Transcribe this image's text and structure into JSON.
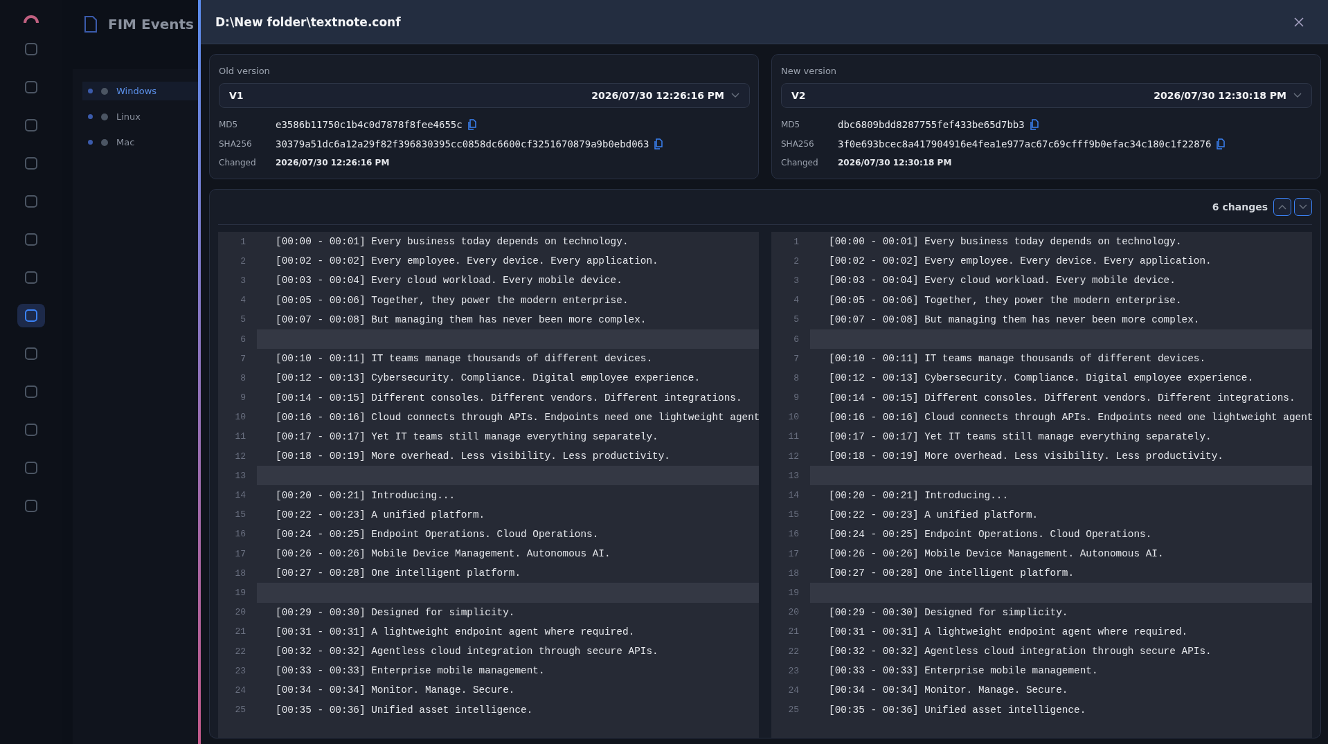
{
  "background_app": {
    "title": "FIM Events",
    "nav_icons": [
      {
        "selected": false
      },
      {
        "selected": false
      },
      {
        "selected": false
      },
      {
        "selected": false
      },
      {
        "selected": false
      },
      {
        "selected": false
      },
      {
        "selected": false
      },
      {
        "selected": true
      },
      {
        "selected": false
      },
      {
        "selected": false
      },
      {
        "selected": false
      },
      {
        "selected": false
      },
      {
        "selected": false
      }
    ],
    "tree": [
      {
        "label": "Windows",
        "selected": true
      },
      {
        "label": "Linux",
        "selected": false
      },
      {
        "label": "Mac",
        "selected": false
      }
    ]
  },
  "dialog": {
    "title": "D:\\New folder\\textnote.conf",
    "versions": [
      {
        "heading": "Old version",
        "version": "V1",
        "date": "2026/07/30 12:26:16 PM",
        "md5_label": "MD5",
        "md5": "e3586b11750c1b4c0d7878f8fee4655c",
        "sha_label": "SHA256",
        "sha256": "30379a51dc6a12a29f82f396830395cc0858dc6600cf3251670879a9b0ebd063",
        "changed_label": "Changed",
        "changed": "2026/07/30 12:26:16 PM"
      },
      {
        "heading": "New version",
        "version": "V2",
        "date": "2026/07/30 12:30:18 PM",
        "md5_label": "MD5",
        "md5": "dbc6809bdd8287755fef433be65d7bb3",
        "sha_label": "SHA256",
        "sha256": "3f0e693bcec8a417904916e4fea1e977ac67c69cfff9b0efac34c180c1f22876",
        "changed_label": "Changed",
        "changed": "2026/07/30 12:30:18 PM"
      }
    ],
    "changes": "6 changes",
    "rows": [
      {
        "old_number": "1",
        "old_text": "[00:00 - 00:01] Every business today depends on technology.",
        "new_number": "1",
        "new_text": "[00:00 - 00:01] Every business today depends on technology.",
        "changed": false
      },
      {
        "old_number": "2",
        "old_text": "[00:02 - 00:02] Every employee. Every device. Every application.",
        "new_number": "2",
        "new_text": "[00:02 - 00:02] Every employee. Every device. Every application.",
        "changed": false
      },
      {
        "old_number": "3",
        "old_text": "[00:03 - 00:04] Every cloud workload. Every mobile device.",
        "new_number": "3",
        "new_text": "[00:03 - 00:04] Every cloud workload. Every mobile device.",
        "changed": false
      },
      {
        "old_number": "4",
        "old_text": "[00:05 - 00:06] Together, they power the modern enterprise.",
        "new_number": "4",
        "new_text": "[00:05 - 00:06] Together, they power the modern enterprise.",
        "changed": false
      },
      {
        "old_number": "5",
        "old_text": "[00:07 - 00:08] But managing them has never been more complex.",
        "new_number": "5",
        "new_text": "[00:07 - 00:08] But managing them has never been more complex.",
        "changed": false
      },
      {
        "old_number": "6",
        "new_number": "6",
        "changed": true
      },
      {
        "old_number": "7",
        "old_text": "[00:10 - 00:11] IT teams manage thousands of different devices.",
        "new_number": "7",
        "new_text": "[00:10 - 00:11] IT teams manage thousands of different devices.",
        "changed": false
      },
      {
        "old_number": "8",
        "old_text": "[00:12 - 00:13] Cybersecurity. Compliance. Digital employee experience.",
        "new_number": "8",
        "new_text": "[00:12 - 00:13] Cybersecurity. Compliance. Digital employee experience.",
        "changed": false
      },
      {
        "old_number": "9",
        "old_text": "[00:14 - 00:15] Different consoles. Different vendors. Different integrations.",
        "new_number": "9",
        "new_text": "[00:14 - 00:15] Different consoles. Different vendors. Different integrations.",
        "changed": false
      },
      {
        "old_number": "10",
        "old_text": "[00:16 - 00:16] Cloud connects through APIs. Endpoints need one lightweight agent",
        "new_number": "10",
        "new_text": "[00:16 - 00:16] Cloud connects through APIs. Endpoints need one lightweight agent",
        "changed": false
      },
      {
        "old_number": "11",
        "old_text": "[00:17 - 00:17] Yet IT teams still manage everything separately.",
        "new_number": "11",
        "new_text": "[00:17 - 00:17] Yet IT teams still manage everything separately.",
        "changed": false
      },
      {
        "old_number": "12",
        "old_text": "[00:18 - 00:19] More overhead. Less visibility. Less productivity.",
        "new_number": "12",
        "new_text": "[00:18 - 00:19] More overhead. Less visibility. Less productivity.",
        "changed": false
      },
      {
        "old_number": "13",
        "new_number": "13",
        "changed": true
      },
      {
        "old_number": "14",
        "old_text": "[00:20 - 00:21] Introducing...",
        "new_number": "14",
        "new_text": "[00:20 - 00:21] Introducing...",
        "changed": false
      },
      {
        "old_number": "15",
        "old_text": "[00:22 - 00:23] A unified platform.",
        "new_number": "15",
        "new_text": "[00:22 - 00:23] A unified platform.",
        "changed": false
      },
      {
        "old_number": "16",
        "old_text": "[00:24 - 00:25] Endpoint Operations. Cloud Operations.",
        "new_number": "16",
        "new_text": "[00:24 - 00:25] Endpoint Operations. Cloud Operations.",
        "changed": false
      },
      {
        "old_number": "17",
        "old_text": "[00:26 - 00:26] Mobile Device Management. Autonomous AI.",
        "new_number": "17",
        "new_text": "[00:26 - 00:26] Mobile Device Management. Autonomous AI.",
        "changed": false
      },
      {
        "old_number": "18",
        "old_text": "[00:27 - 00:28] One intelligent platform.",
        "new_number": "18",
        "new_text": "[00:27 - 00:28] One intelligent platform.",
        "changed": false
      },
      {
        "old_number": "19",
        "new_number": "19",
        "changed": true
      },
      {
        "old_number": "20",
        "old_text": "[00:29 - 00:30] Designed for simplicity.",
        "new_number": "20",
        "new_text": "[00:29 - 00:30] Designed for simplicity.",
        "changed": false
      },
      {
        "old_number": "21",
        "old_text": "[00:31 - 00:31] A lightweight endpoint agent where required.",
        "new_number": "21",
        "new_text": "[00:31 - 00:31] A lightweight endpoint agent where required.",
        "changed": false
      },
      {
        "old_number": "22",
        "old_text": "[00:32 - 00:32] Agentless cloud integration through secure APIs.",
        "new_number": "22",
        "new_text": "[00:32 - 00:32] Agentless cloud integration through secure APIs.",
        "changed": false
      },
      {
        "old_number": "23",
        "old_text": "[00:33 - 00:33] Enterprise mobile management.",
        "new_number": "23",
        "new_text": "[00:33 - 00:33] Enterprise mobile management.",
        "changed": false
      },
      {
        "old_number": "24",
        "old_text": "[00:34 - 00:34] Monitor. Manage. Secure.",
        "new_number": "24",
        "new_text": "[00:34 - 00:34] Monitor. Manage. Secure.",
        "changed": false
      },
      {
        "old_number": "25",
        "old_text": "[00:35 - 00:36] Unified asset intelligence.",
        "new_number": "25",
        "new_text": "[00:35 - 00:36] Unified asset intelligence.",
        "changed": false
      }
    ]
  }
}
